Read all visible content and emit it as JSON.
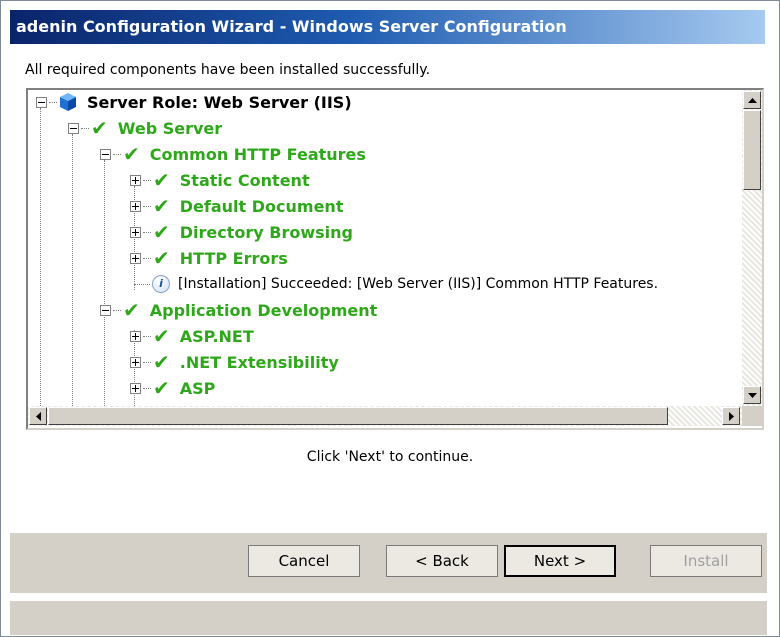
{
  "window": {
    "title": "adenin Configuration Wizard - Windows Server Configuration"
  },
  "message": "All required components have been installed successfully.",
  "tree": {
    "root": {
      "label": "Server Role: Web Server (IIS)",
      "icon": "server-role-icon"
    },
    "web_server": {
      "label": "Web Server"
    },
    "common_http": {
      "label": "Common HTTP Features"
    },
    "static_content": {
      "label": "Static Content"
    },
    "default_document": {
      "label": "Default Document"
    },
    "directory_browsing": {
      "label": "Directory Browsing"
    },
    "http_errors": {
      "label": "HTTP Errors"
    },
    "installation_info": {
      "label": "[Installation] Succeeded: [Web Server (IIS)] Common HTTP Features."
    },
    "app_dev": {
      "label": "Application Development"
    },
    "aspnet": {
      "label": "ASP.NET"
    },
    "net_ext": {
      "label": ".NET Extensibility"
    },
    "asp": {
      "label": "ASP"
    }
  },
  "continue_text": "Click 'Next' to continue.",
  "buttons": {
    "cancel": "Cancel",
    "back": "< Back",
    "next": "Next >",
    "install": "Install"
  },
  "colors": {
    "success_green": "#2ea81a",
    "title_blue": "#0a246a"
  }
}
